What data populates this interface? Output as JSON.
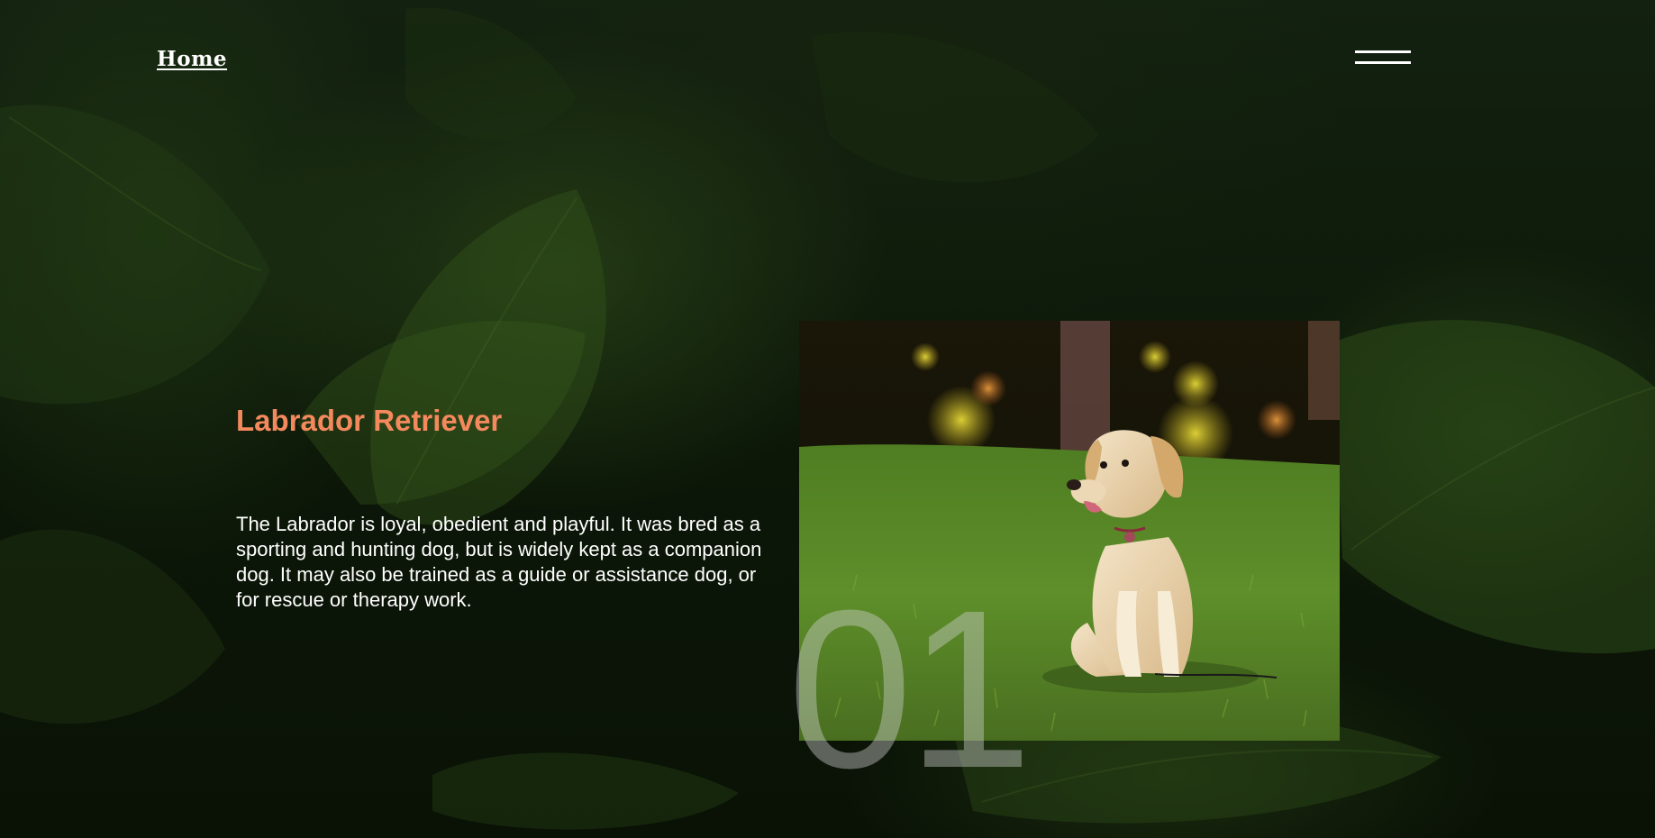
{
  "nav": {
    "home_label": "Home",
    "menu_icon": "hamburger-menu-icon"
  },
  "hero": {
    "title": "Labrador Retriever",
    "description": "The Labrador is loyal, obedient and playful. It was bred as a sporting and hunting dog, but is widely kept as a companion dog. It may also be trained as a guide or assistance dog, or for rescue or therapy work.",
    "slide_number": "01",
    "image_subject": "puppy sitting on grass"
  },
  "colors": {
    "title_accent": "#f4895e",
    "text": "#ffffff",
    "background": "#0c1708"
  }
}
